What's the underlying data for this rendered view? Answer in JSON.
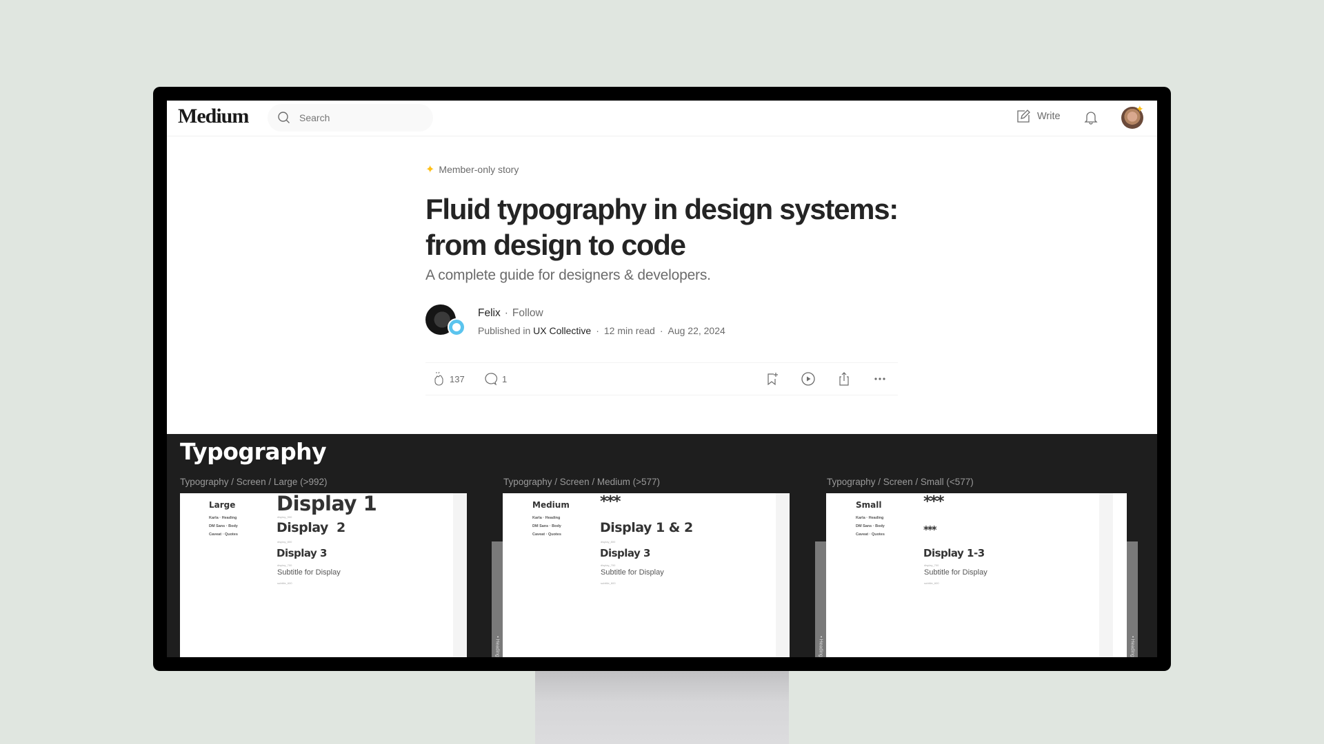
{
  "header": {
    "logo": "Medium",
    "search_placeholder": "Search",
    "write_label": "Write",
    "icons": [
      "search-icon",
      "write-icon",
      "bell-icon",
      "user-avatar"
    ]
  },
  "article": {
    "badge": "Member-only story",
    "title": "Fluid typography in design systems: from design to code",
    "subtitle": "A complete guide for designers & developers.",
    "author": "Felix",
    "separator": "·",
    "follow_label": "Follow",
    "published_in_label": "Published in",
    "publication": "UX Collective",
    "read_time": "12 min read",
    "date": "Aug 22, 2024",
    "claps": "137",
    "comments": "1",
    "colors": {
      "member_star": "#ffc017",
      "text": "#242424",
      "muted": "#6b6b6b"
    }
  },
  "typography_section": {
    "title": "Typography",
    "columns": [
      {
        "breadcrumb": "Typography / Screen / Large (>992)",
        "label": "Large",
        "fonts": [
          "Karla · Heading",
          "DM Sans · Body",
          "Caveat · Quotes"
        ],
        "styles": [
          {
            "name": "Display 1",
            "token": "display_900"
          },
          {
            "name": "Display  2",
            "token": "display_800"
          },
          {
            "name": "Display 3",
            "token": "display_700"
          },
          {
            "name": "Subtitle for Display",
            "token": "subtitle_600"
          }
        ]
      },
      {
        "breadcrumb": "Typography / Screen / Medium (>577)",
        "label": "Medium",
        "fonts": [
          "Karla · Heading",
          "DM Sans · Body",
          "Caveat · Quotes"
        ],
        "placeholder": "***",
        "styles": [
          {
            "name": "Display 1 & 2",
            "token": "display_800"
          },
          {
            "name": "Display 3",
            "token": "display_700"
          },
          {
            "name": "Subtitle for Display",
            "token": "subtitle_600"
          }
        ],
        "side_tab": "• Heading"
      },
      {
        "breadcrumb": "Typography / Screen / Small (<577)",
        "label": "Small",
        "fonts": [
          "Karla · Heading",
          "DM Sans · Body",
          "Caveat · Quotes"
        ],
        "placeholder_large": "***",
        "placeholder_small": "***",
        "styles": [
          {
            "name": "Display 1-3",
            "token": "display_700"
          },
          {
            "name": "Subtitle for Display",
            "token": "subtitle_600"
          }
        ],
        "side_tab": "• Heading"
      }
    ]
  }
}
